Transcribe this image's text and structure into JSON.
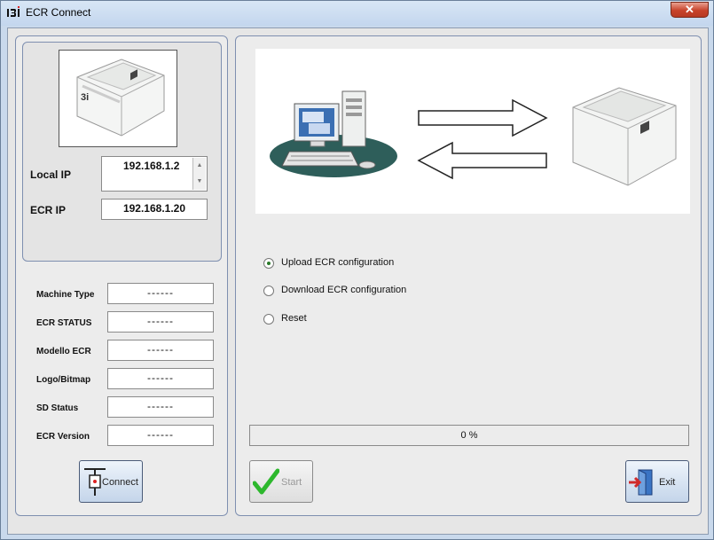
{
  "window": {
    "title": "ECR Connect",
    "close_label": "✕"
  },
  "left": {
    "local_ip_label": "Local IP",
    "local_ip_value": "192.168.1.2",
    "ecr_ip_label": "ECR IP",
    "ecr_ip_value": "192.168.1.20",
    "info_rows": [
      {
        "label": "Machine Type",
        "value": "------"
      },
      {
        "label": "ECR STATUS",
        "value": "------"
      },
      {
        "label": "Modello ECR",
        "value": "------"
      },
      {
        "label": "Logo/Bitmap",
        "value": "------"
      },
      {
        "label": "SD Status",
        "value": "------"
      },
      {
        "label": "ECR Version",
        "value": "------"
      }
    ],
    "connect_label": "Connect"
  },
  "right": {
    "options": [
      {
        "label": "Upload ECR configuration",
        "checked": true
      },
      {
        "label": "Download ECR configuration",
        "checked": false
      },
      {
        "label": "Reset",
        "checked": false
      }
    ],
    "progress_text": "0 %",
    "progress_value": 0,
    "start_label": "Start",
    "exit_label": "Exit"
  },
  "colors": {
    "client_bg": "#e6e6e6",
    "panel_border": "#7e8fb0",
    "check_green": "#2db82d",
    "exit_red": "#d02a2a"
  }
}
